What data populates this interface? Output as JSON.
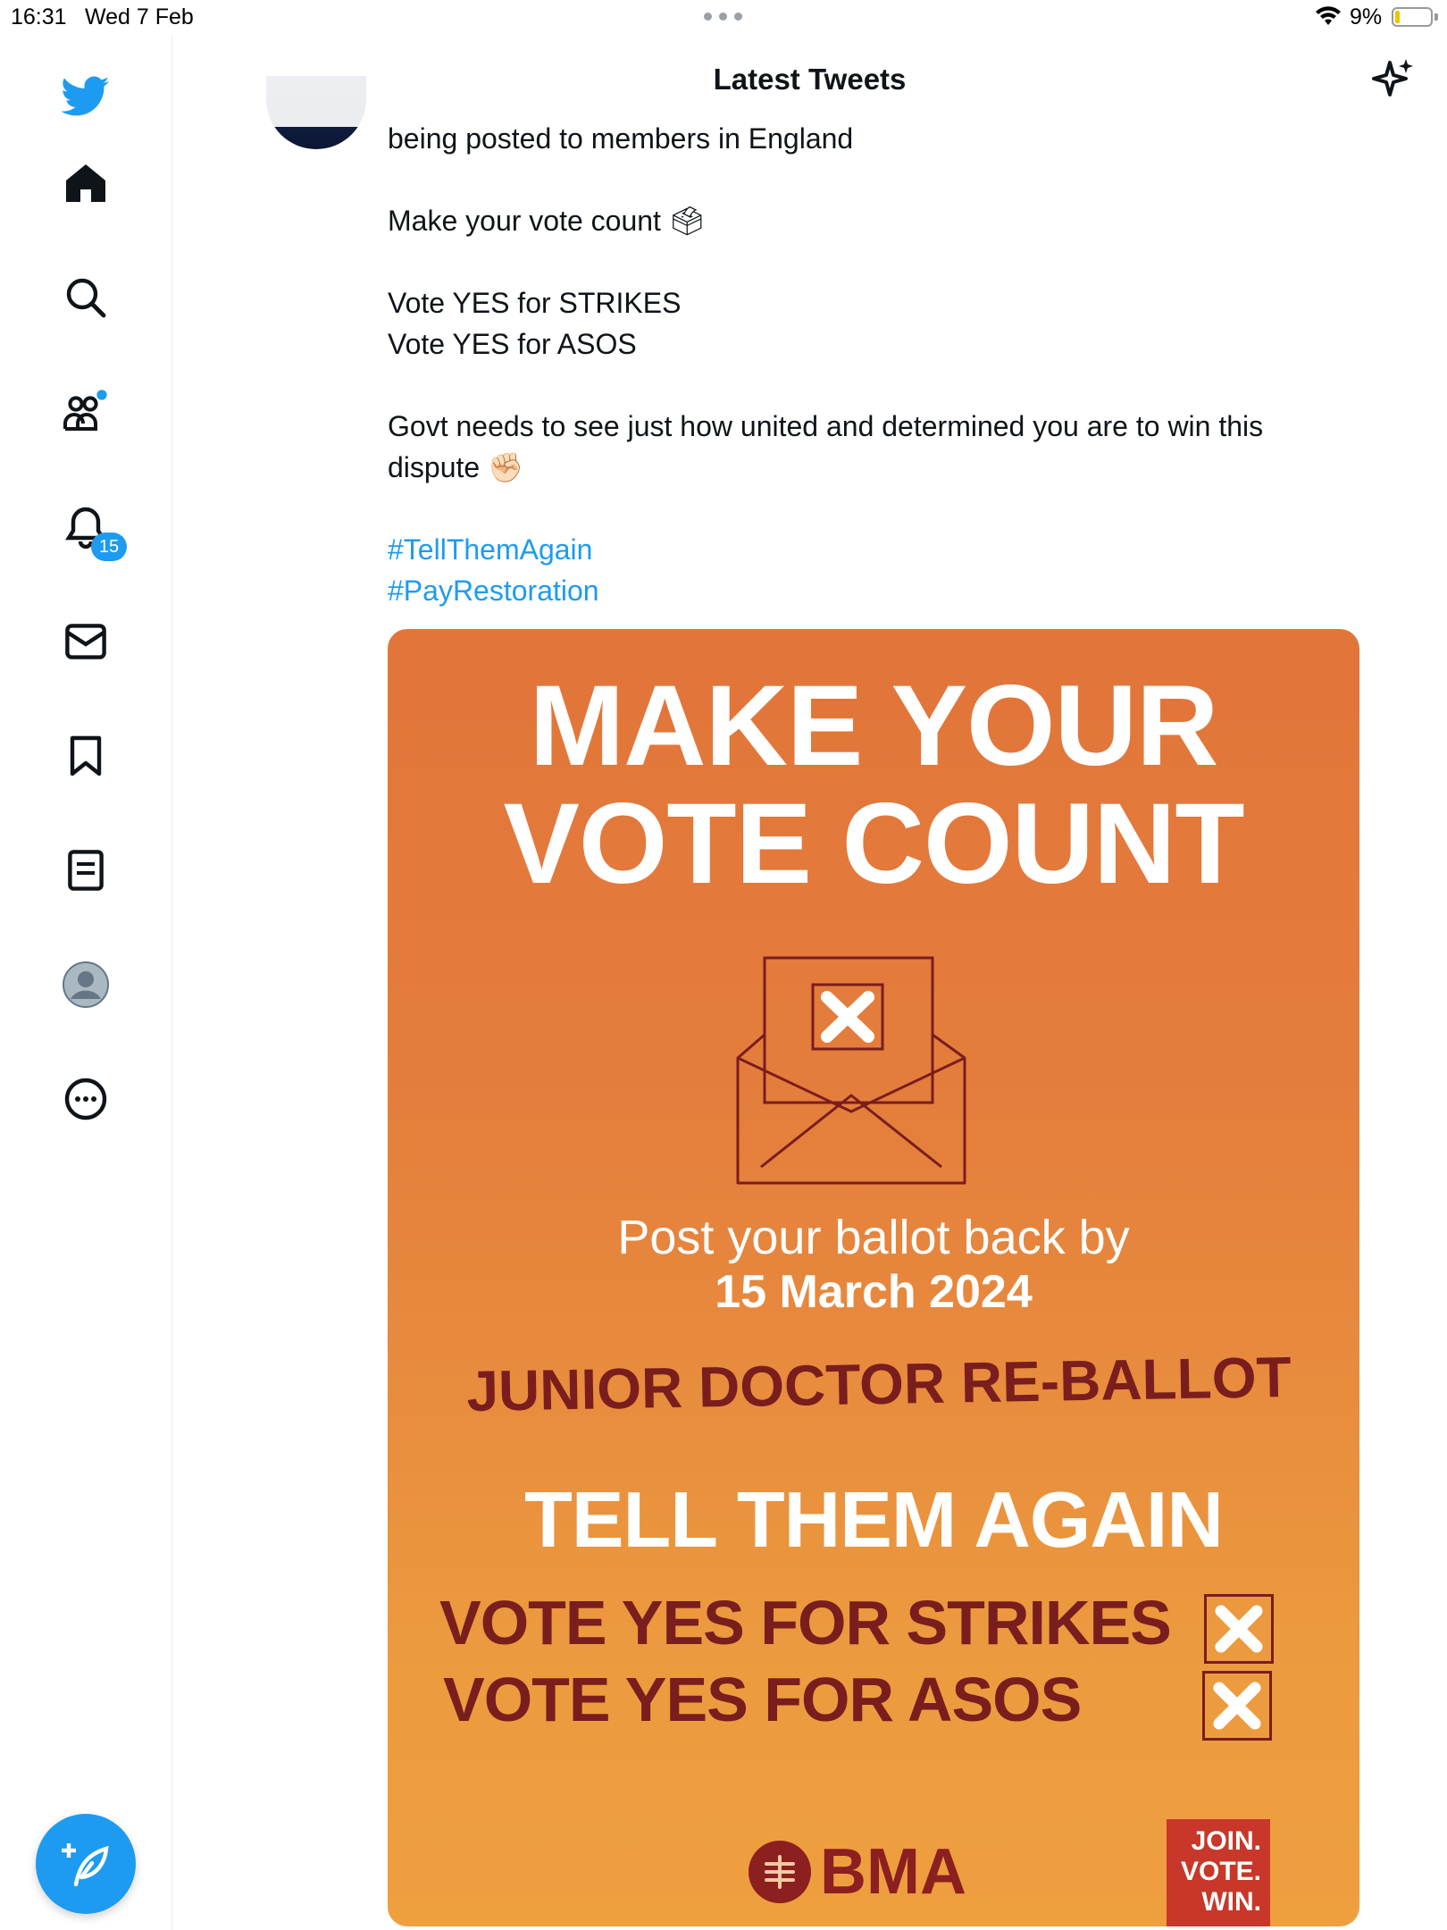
{
  "status_bar": {
    "time": "16:31",
    "date": "Wed 7 Feb",
    "battery": "9%"
  },
  "sidebar": {
    "items": [
      {
        "name": "home-icon"
      },
      {
        "name": "search-icon"
      },
      {
        "name": "communities-icon"
      },
      {
        "name": "notifications-icon",
        "badge": "15"
      },
      {
        "name": "messages-icon"
      },
      {
        "name": "bookmarks-icon"
      },
      {
        "name": "lists-icon"
      },
      {
        "name": "profile-avatar-icon"
      },
      {
        "name": "more-icon"
      }
    ],
    "compose_icon": "feather-plus-icon"
  },
  "header": {
    "title": "Latest Tweets",
    "sparkle_icon": "sparkle-icon"
  },
  "tweet": {
    "lines": {
      "l1": "being posted to members in England",
      "l2": "Make your vote count 🗳",
      "l3": "Vote YES for STRIKES",
      "l4": "Vote YES for ASOS",
      "l5": "Govt needs to see just how united and determined you are to win this",
      "l6": "dispute ✊🏻"
    },
    "hashtags": [
      "#TellThemAgain",
      "#PayRestoration"
    ]
  },
  "poster": {
    "title_line1": "MAKE YOUR",
    "title_line2": "VOTE COUNT",
    "post_text": "Post your ballot back by",
    "date": "15 March 2024",
    "junior": "JUNIOR DOCTOR RE-BALLOT",
    "tell": "TELL THEM AGAIN",
    "vote1": "VOTE YES FOR STRIKES",
    "vote2": "VOTE YES FOR ASOS",
    "bma": "BMA",
    "jvw": [
      "JOIN.",
      "VOTE.",
      "WIN."
    ]
  },
  "colors": {
    "accent": "#1d9bf0",
    "poster_orange": "#e47d3c",
    "poster_maroon": "#7a1d1d"
  }
}
